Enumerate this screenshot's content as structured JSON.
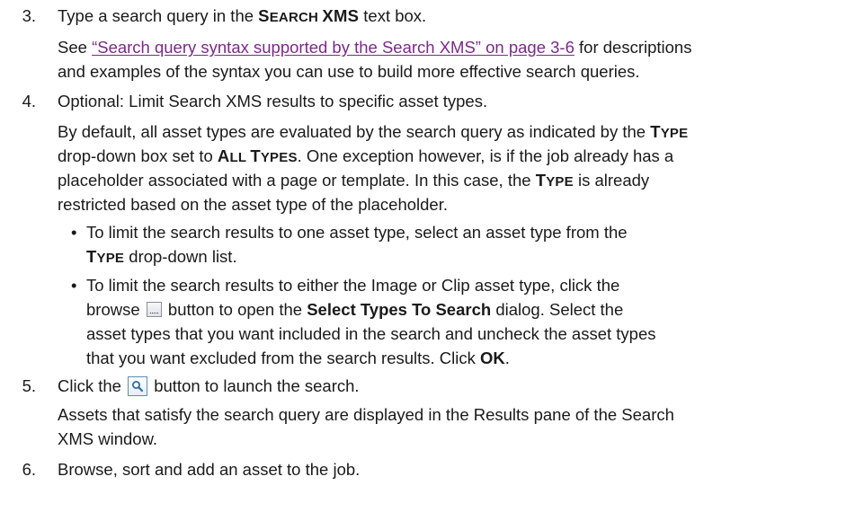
{
  "step3": {
    "num": "3.",
    "prefix": "Type a search query in the ",
    "field_cap": "S",
    "field_rest": "EARCH",
    "field_xms": "XMS",
    "suffix": " text box.",
    "see": "See ",
    "link": "“Search query syntax supported by the Search XMS” on page 3-6",
    "after_link": " for descriptions",
    "line3": "and examples of the syntax you can use to build more effective search queries."
  },
  "step4": {
    "num": "4.",
    "title": "Optional: Limit Search XMS results to specific asset types.",
    "p1_a": "By default, all asset types are evaluated by the search query as indicated by the ",
    "type_cap": "T",
    "type_rest": "YPE",
    "p2_a": "drop-down box set to ",
    "all_cap": "A",
    "all_rest": "LL ",
    "types_cap": "T",
    "types_rest": "YPES",
    "p2_b": ". One exception however, is if the job already has a",
    "p3": "placeholder associated with a page or template. In this case, the ",
    "p3_b": " is already",
    "p4": "restricted based on the asset type of the placeholder.",
    "bullet_char": "•",
    "b1_l1": "To limit the search results to one asset type, select an asset type from the",
    "b1_l2_b": " drop-down list.",
    "b2_l1": "To limit the search results to either the Image or Clip asset type, click the",
    "b2_l2_a": "browse ",
    "b2_l2_b": " button to open the ",
    "b2_dialog": "Select Types To Search",
    "b2_l2_c": " dialog. Select the",
    "b2_l3": "asset types that you want included in the search and uncheck the asset types",
    "b2_l4_a": "that you want excluded from the search results. Click ",
    "b2_ok": "OK",
    "b2_l4_b": "."
  },
  "step5": {
    "num": "5.",
    "a": "Click the ",
    "b": " button to launch the search.",
    "l2": "Assets that satisfy the search query are displayed in the Results pane of the Search",
    "l3": "XMS window."
  },
  "step6": {
    "num": "6.",
    "text": "Browse, sort and add an asset to the job."
  },
  "icons": {
    "browse": "browse-ellipsis-icon",
    "search": "magnifier-search-icon"
  }
}
